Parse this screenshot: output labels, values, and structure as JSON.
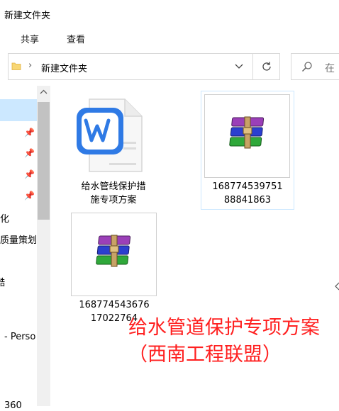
{
  "window": {
    "title": "新建文件夹"
  },
  "ribbon": {
    "tabs": [
      "共享",
      "查看"
    ]
  },
  "address": {
    "path": "新建文件夹",
    "search_placeholder": "在"
  },
  "nav": {
    "items": [
      {
        "label": "",
        "pinned": true
      },
      {
        "label": "",
        "pinned": true
      },
      {
        "label": "",
        "pinned": true
      },
      {
        "label": "",
        "pinned": true
      },
      {
        "label": "化"
      },
      {
        "label": "质量策划"
      },
      {
        "label": "酷"
      },
      {
        "label": "- Perso"
      },
      {
        "label": "360"
      }
    ]
  },
  "files": [
    {
      "name_line1": "给水管线保护措",
      "name_line2": "施专项方案",
      "type": "wps-doc"
    },
    {
      "name_line1": "168774539751",
      "name_line2": "88841863",
      "type": "rar",
      "selected": true
    },
    {
      "name_line1": "168774543676",
      "name_line2": "17022764",
      "type": "rar"
    }
  ],
  "overlay": {
    "text": "给水管道保护专项方案（西南工程联盟）"
  }
}
